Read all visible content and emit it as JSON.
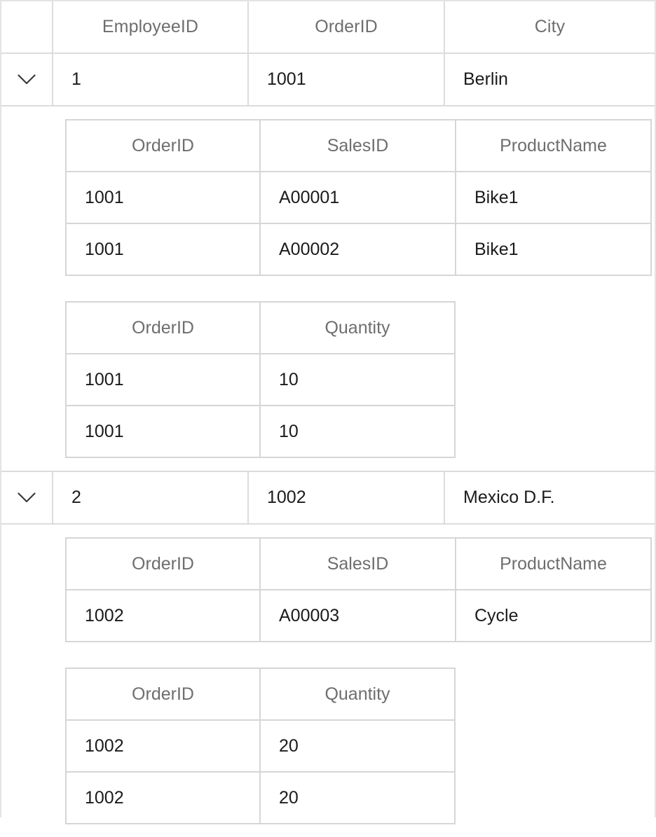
{
  "grid": {
    "toggle_icon": "chevron-down-icon",
    "columns": [
      "EmployeeID",
      "OrderID",
      "City"
    ],
    "rows": [
      {
        "expanded": true,
        "EmployeeID": "1",
        "OrderID": "1001",
        "City": "Berlin",
        "detail_tables": [
          {
            "name": "sales-detail-table",
            "width": "sales",
            "columns": [
              "OrderID",
              "SalesID",
              "ProductName"
            ],
            "rows": [
              [
                "1001",
                "A00001",
                "Bike1"
              ],
              [
                "1001",
                "A00002",
                "Bike1"
              ]
            ]
          },
          {
            "name": "quantity-detail-table",
            "width": "qty",
            "columns": [
              "OrderID",
              "Quantity"
            ],
            "rows": [
              [
                "1001",
                "10"
              ],
              [
                "1001",
                "10"
              ]
            ]
          }
        ]
      },
      {
        "expanded": true,
        "EmployeeID": "2",
        "OrderID": "1002",
        "City": "Mexico D.F.",
        "detail_tables": [
          {
            "name": "sales-detail-table",
            "width": "sales",
            "columns": [
              "OrderID",
              "SalesID",
              "ProductName"
            ],
            "rows": [
              [
                "1002",
                "A00003",
                "Cycle"
              ]
            ]
          },
          {
            "name": "quantity-detail-table",
            "width": "qty",
            "columns": [
              "OrderID",
              "Quantity"
            ],
            "rows": [
              [
                "1002",
                "20"
              ],
              [
                "1002",
                "20"
              ]
            ]
          }
        ]
      }
    ]
  },
  "colors": {
    "header_text": "#6e6e6e",
    "cell_text": "#1b1b1b",
    "border": "#dcdcdc",
    "nested_border": "#d6d6d6",
    "background": "#ffffff"
  }
}
